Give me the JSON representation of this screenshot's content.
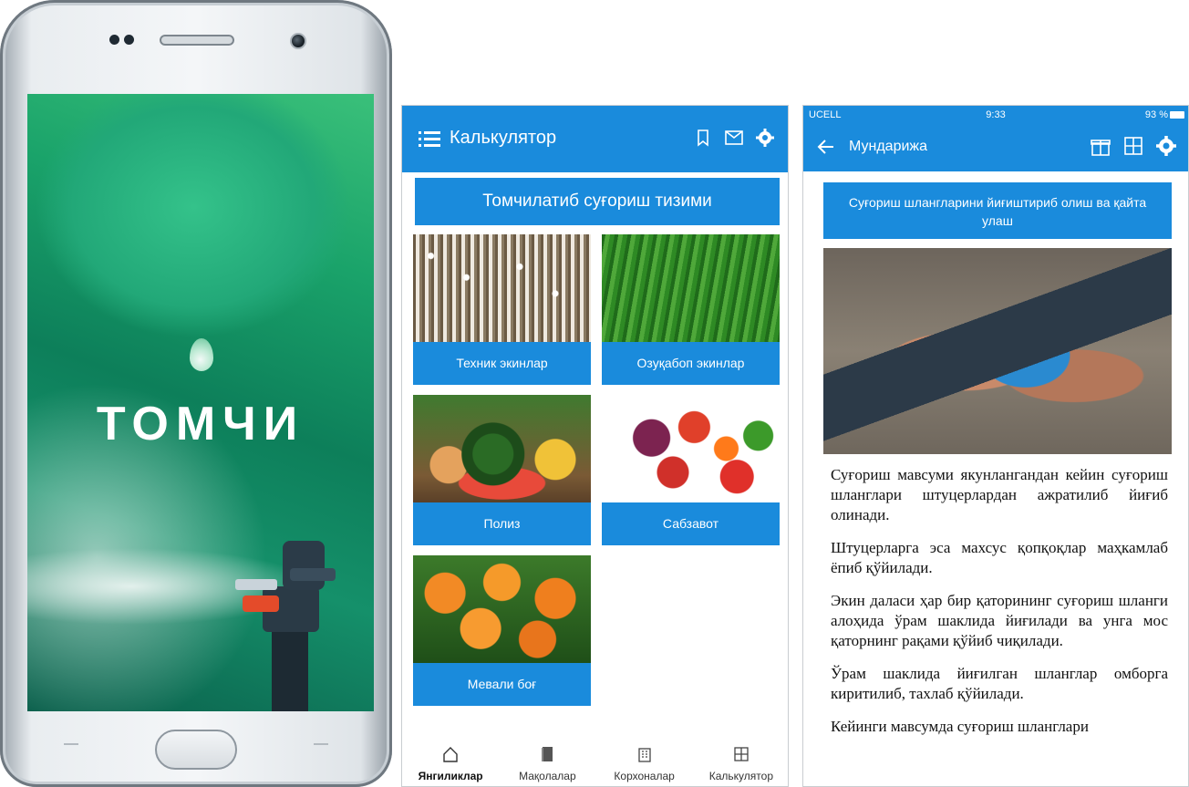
{
  "splash": {
    "brand": "ТОМЧИ"
  },
  "calculator_screen": {
    "title": "Калькулятор",
    "banner": "Томчилатиб суғориш тизими",
    "categories": [
      {
        "label": "Техник экинлар",
        "image": "cotton-field"
      },
      {
        "label": "Озуқабоп экинлар",
        "image": "corn-field"
      },
      {
        "label": "Полиз",
        "image": "melons"
      },
      {
        "label": "Сабзавот",
        "image": "vegetables"
      },
      {
        "label": "Мевали боғ",
        "image": "fruit-tree"
      }
    ],
    "bottom_nav": [
      {
        "label": "Янгиликлар",
        "icon": "home-icon",
        "active": true
      },
      {
        "label": "Мақолалар",
        "icon": "book-icon",
        "active": false
      },
      {
        "label": "Корхоналар",
        "icon": "building-icon",
        "active": false
      },
      {
        "label": "Калькулятор",
        "icon": "calculator-icon",
        "active": false
      }
    ],
    "colors": {
      "primary": "#1a8bdc"
    }
  },
  "article_screen": {
    "status": {
      "carrier": "UCELL",
      "time": "9:33",
      "battery": "93 %"
    },
    "title": "Мундарижа",
    "banner": "Суғориш шлангларини йиғиштириб олиш ва қайта улаш",
    "paragraphs": [
      "Суғориш мавсуми якунлангандан кейин суғориш шланглари штуцерлардан ажратилиб йиғиб олинади.",
      "Штуцерларга эса махсус қопқоқлар маҳкамлаб ёпиб қўйилади.",
      "Экин даласи ҳар бир қаторининг суғориш шланги алоҳида ўрам шаклида йиғилади ва унга мос қаторнинг рақами қўйиб чиқилади.",
      "Ўрам шаклида йиғилган шланглар омборга киритилиб, тахлаб қўйилади.",
      "Кейинги мавсумда суғориш шланглари"
    ]
  }
}
